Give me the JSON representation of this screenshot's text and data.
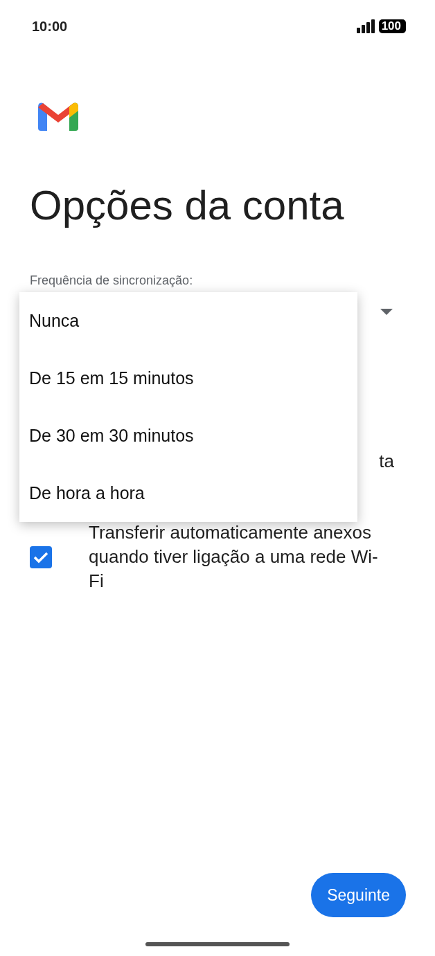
{
  "status_bar": {
    "time": "10:00",
    "battery": "100"
  },
  "title": "Opções da conta",
  "sync_frequency": {
    "label": "Frequência de sincronização:",
    "expanded": true,
    "options": [
      {
        "label": "Nunca"
      },
      {
        "label": "De 15 em 15 minutos"
      },
      {
        "label": "De 30 em 30 minutos"
      },
      {
        "label": "De hora a hora"
      }
    ]
  },
  "hidden_row_fragment": "ta",
  "attachments_checkbox": {
    "label": "Transferir automaticamente anexos quando tiver ligação a uma rede Wi-Fi",
    "checked": true
  },
  "next_button": "Seguinte"
}
